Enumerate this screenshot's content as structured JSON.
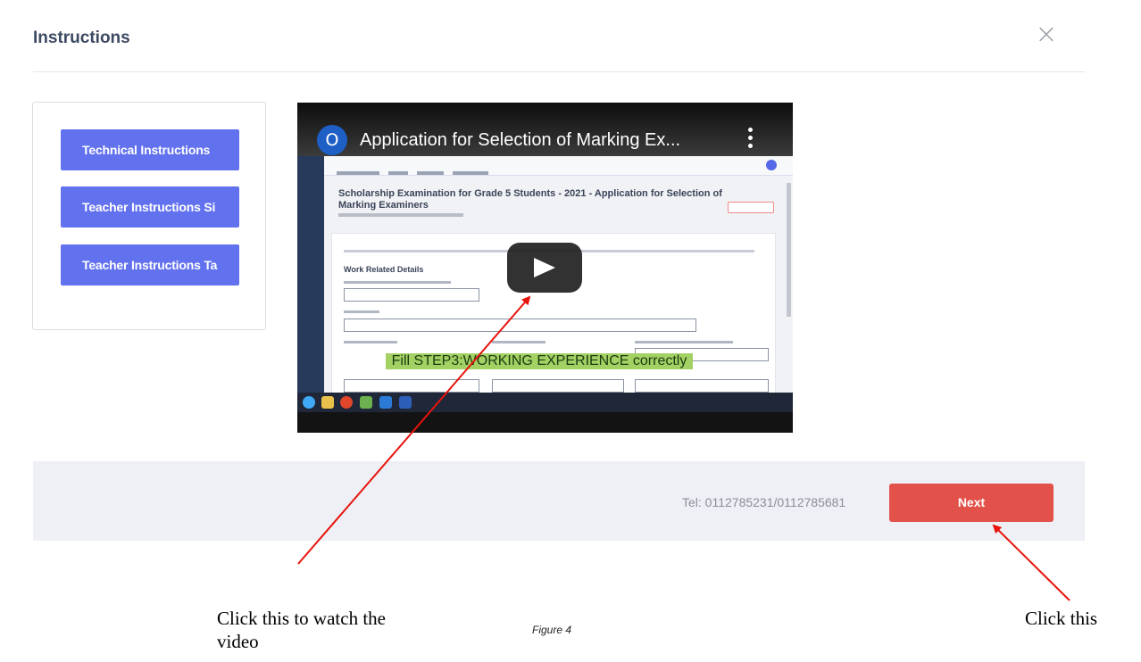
{
  "modal": {
    "title": "Instructions",
    "close_icon": "close-icon"
  },
  "sidebar": {
    "buttons": [
      {
        "label": "Technical Instructions"
      },
      {
        "label": "Teacher Instructions Si"
      },
      {
        "label": "Teacher Instructions Ta"
      }
    ],
    "button_color": "#6271ee"
  },
  "video": {
    "channel_initial": "O",
    "title": "Application for Selection of Marking Ex...",
    "menu_icon": "more-vertical-icon",
    "play_icon": "play-icon",
    "screen_heading": "Scholarship Examination for Grade 5 Students - 2021 - Application for Selection of Marking Examiners",
    "section_title": "Work Related Details",
    "caption": "Fill STEP3:WORKING EXPERIENCE correctly",
    "caption_color": "#a3d164"
  },
  "footer": {
    "tel": "Tel: 0112785231/0112785681",
    "next_label": "Next",
    "next_color": "#e2514a"
  },
  "annotations": {
    "left_note": "Click this to watch the video",
    "right_note": "Click this",
    "figure_caption": "Figure 4",
    "arrow_color": "#e8130c"
  }
}
